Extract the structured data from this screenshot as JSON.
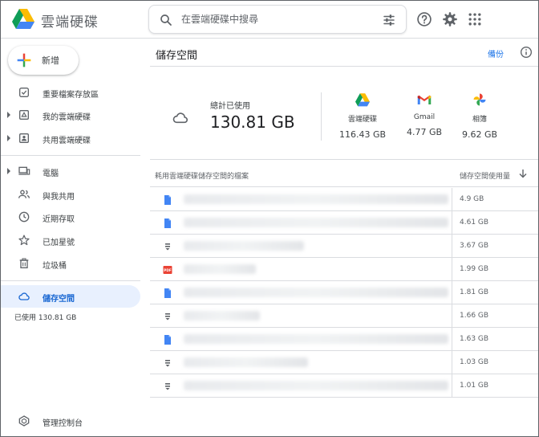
{
  "header": {
    "app_title": "雲端硬碟",
    "search_placeholder": "在雲端硬碟中搜尋"
  },
  "sidebar": {
    "new_label": "新增",
    "items": [
      {
        "label": "重要檔案存放區",
        "icon": "priority-icon"
      },
      {
        "label": "我的雲端硬碟",
        "icon": "my-drive-icon"
      },
      {
        "label": "共用雲端硬碟",
        "icon": "shared-drives-icon"
      },
      {
        "label": "電腦",
        "icon": "computers-icon"
      },
      {
        "label": "與我共用",
        "icon": "shared-with-me-icon"
      },
      {
        "label": "近期存取",
        "icon": "recent-icon"
      },
      {
        "label": "已加星號",
        "icon": "starred-icon"
      },
      {
        "label": "垃圾桶",
        "icon": "trash-icon"
      },
      {
        "label": "儲存空間",
        "icon": "cloud-icon"
      }
    ],
    "usage_text": "已使用 130.81 GB",
    "admin_label": "管理控制台"
  },
  "main": {
    "title": "儲存空間",
    "backup_label": "備份",
    "total_label": "總計已使用",
    "total_value": "130.81 GB",
    "services": [
      {
        "name": "雲端硬碟",
        "value": "116.43 GB",
        "icon": "drive-logo-icon"
      },
      {
        "name": "Gmail",
        "value": "4.77 GB",
        "icon": "gmail-logo-icon"
      },
      {
        "name": "相簿",
        "value": "9.62 GB",
        "icon": "photos-logo-icon"
      }
    ],
    "list_header": {
      "name_col": "耗用雲端硬碟儲存空間的檔案",
      "size_col": "儲存空間使用量"
    },
    "files": [
      {
        "type": "doc",
        "size": "4.9 GB"
      },
      {
        "type": "doc",
        "size": "4.61 GB"
      },
      {
        "type": "video",
        "size": "3.67 GB"
      },
      {
        "type": "pdf",
        "size": "1.99 GB"
      },
      {
        "type": "doc",
        "size": "1.81 GB"
      },
      {
        "type": "video",
        "size": "1.66 GB"
      },
      {
        "type": "doc",
        "size": "1.63 GB"
      },
      {
        "type": "video",
        "size": "1.03 GB"
      },
      {
        "type": "video",
        "size": "1.01 GB"
      }
    ]
  },
  "colors": {
    "accent": "#1a73e8",
    "active_bg": "#e8f0fe",
    "divider": "#dadce0",
    "pdf_red": "#ea4335"
  }
}
